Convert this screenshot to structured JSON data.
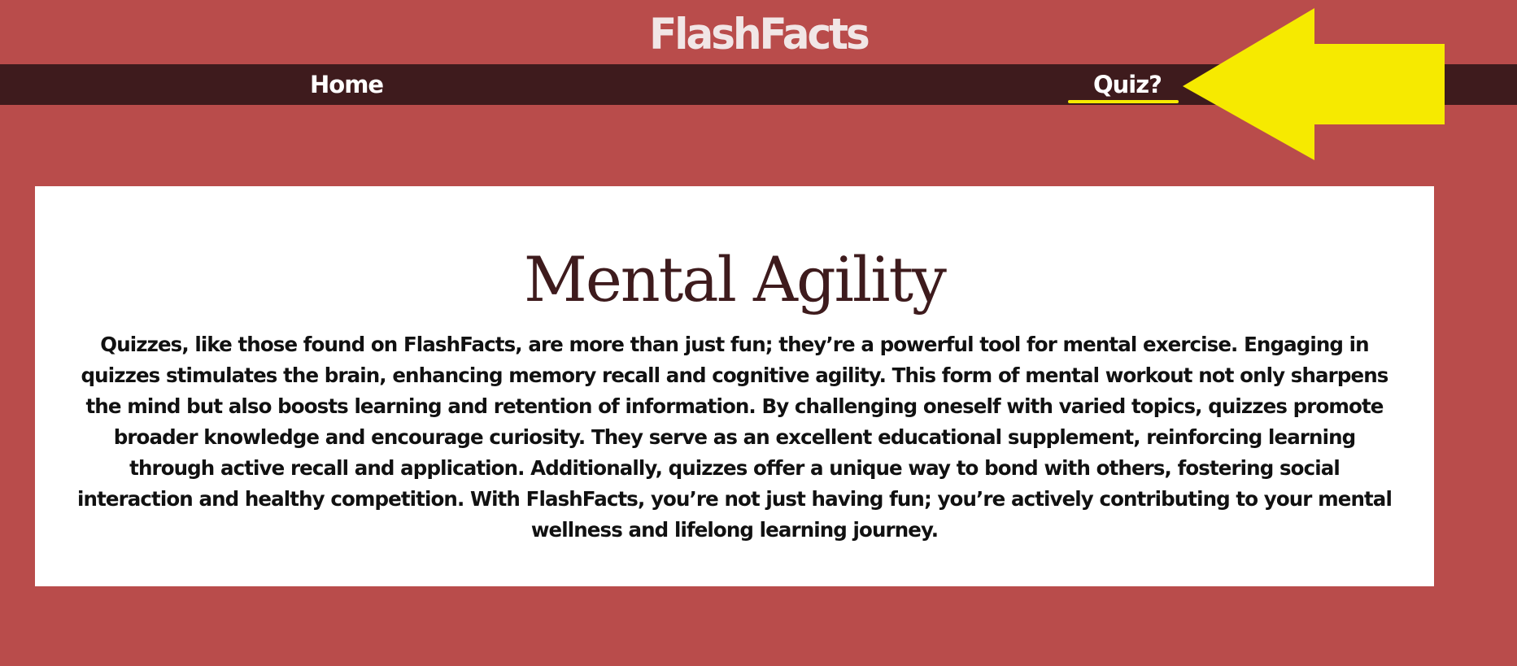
{
  "header": {
    "site_title": "FlashFacts"
  },
  "nav": {
    "home_label": "Home",
    "quiz_label": "Quiz?"
  },
  "annotation": {
    "arrow_color": "#f6ea00",
    "arrow_icon": "left-arrow-icon"
  },
  "main": {
    "heading": "Mental Agility",
    "paragraph": "Quizzes, like those found on FlashFacts, are more than just fun; they’re a powerful tool for mental exercise. Engaging in quizzes stimulates the brain, enhancing memory recall and cognitive agility. This form of mental workout not only sharpens the mind but also boosts learning and retention of information. By challenging oneself with varied topics, quizzes promote broader knowledge and encourage curiosity. They serve as an excellent educational supplement, reinforcing learning through active recall and application. Additionally, quizzes offer a unique way to bond with others, fostering social interaction and healthy competition. With FlashFacts, you’re not just having fun; you’re actively contributing to your mental wellness and lifelong learning journey."
  },
  "colors": {
    "page_background": "#b94c4b",
    "navbar_background": "#3e1b1d",
    "card_background": "#ffffff",
    "heading_color": "#3e1b1d",
    "highlight": "#f6ea00"
  }
}
